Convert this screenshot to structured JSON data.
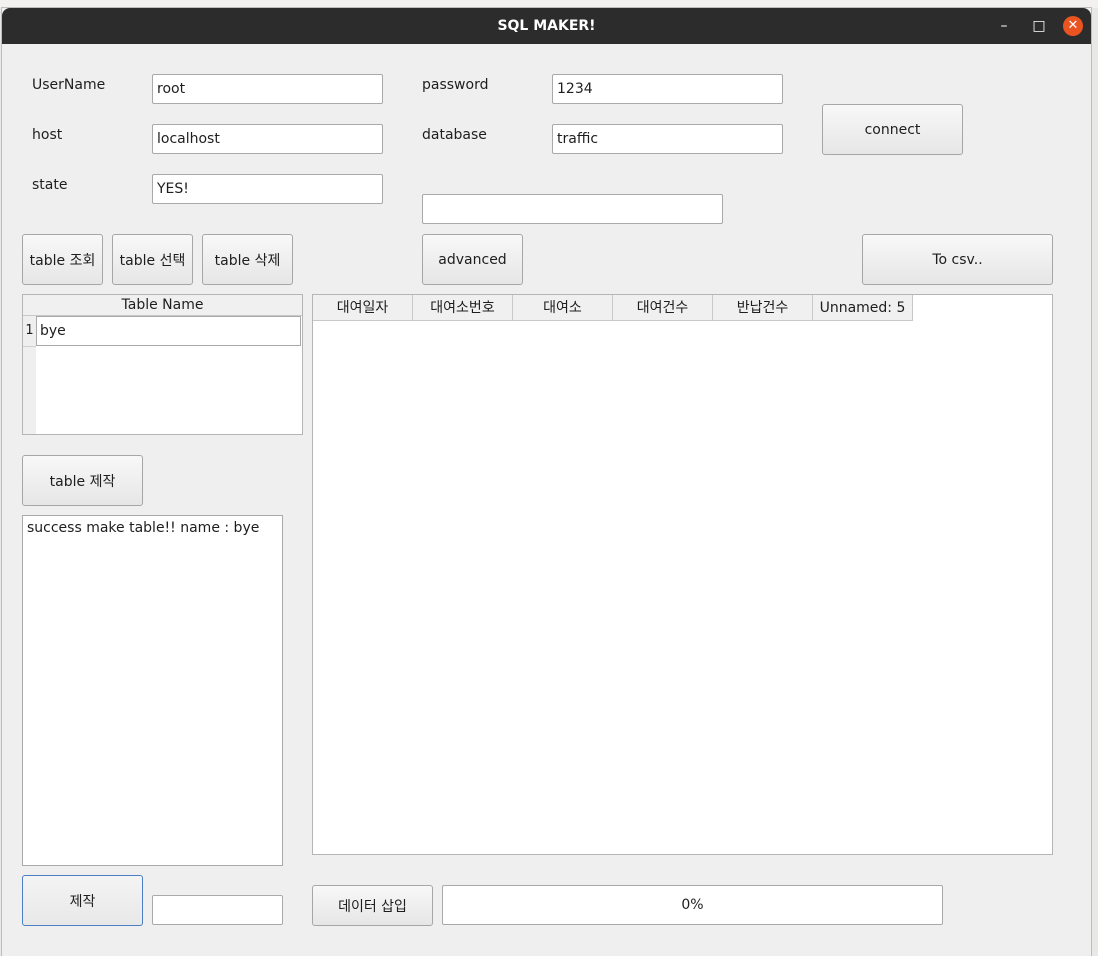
{
  "window": {
    "title": "SQL MAKER!"
  },
  "connection": {
    "username_label": "UserName",
    "username_value": "root",
    "password_label": "password",
    "password_value": "1234",
    "host_label": "host",
    "host_value": "localhost",
    "database_label": "database",
    "database_value": "traffic",
    "state_label": "state",
    "state_value": "YES!",
    "connect_label": "connect",
    "extra_value": ""
  },
  "toolbar": {
    "table_query": "table 조회",
    "table_select": "table 선택",
    "table_delete": "table 삭제",
    "advanced": "advanced",
    "to_csv": "To csv.."
  },
  "table_list": {
    "header": "Table Name",
    "rows": [
      {
        "num": "1",
        "name": "bye"
      }
    ]
  },
  "create": {
    "make_table_label": "table 제작",
    "log_text": "success make table!! name : bye",
    "make_label": "제작",
    "make_input_value": ""
  },
  "data_grid": {
    "columns": [
      "대여일자",
      "대여소번호",
      "대여소",
      "대여건수",
      "반납건수",
      "Unnamed: 5"
    ]
  },
  "insert": {
    "insert_label": "데이터 삽입",
    "progress_text": "0%",
    "progress_value": 0
  }
}
